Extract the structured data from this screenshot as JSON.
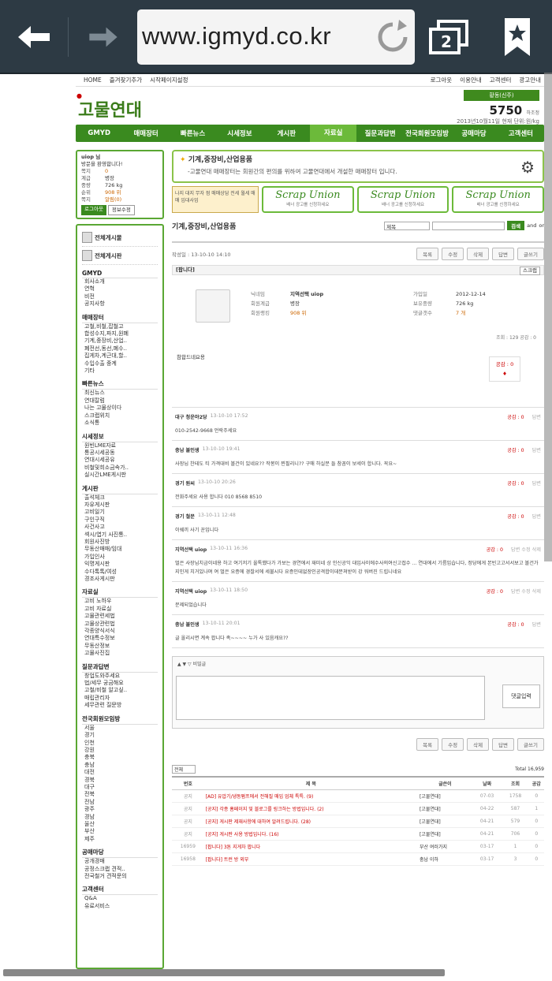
{
  "browser": {
    "url": "www.igmyd.co.kr",
    "tab_count": "2"
  },
  "topbar": {
    "links": [
      "HOME",
      "즐겨찾기추가",
      "시작페이지설정"
    ],
    "right": [
      "로그아웃",
      "이용안내",
      "고객센터",
      "광고안내"
    ]
  },
  "header": {
    "logo": "고물연대",
    "price_label": "황동(신주)",
    "price_value": "5750",
    "price_unit": "하조정",
    "price_date": "2013년10월11일 현재 단위:원/kg"
  },
  "gnav": [
    "GMYD",
    "매매장터",
    "빠른뉴스",
    "시세정보",
    "게시판",
    "자료실",
    "질문과답변",
    "전국회원모임방",
    "공매마당",
    "고객센터"
  ],
  "login": {
    "greet1": "uiop 님",
    "greet2": "방문을 환영합니다!",
    "rows": [
      {
        "k": "쪽지",
        "v": "0"
      },
      {
        "k": "계급",
        "v": "병장"
      },
      {
        "k": "중량",
        "v": "726 kg"
      },
      {
        "k": "순위",
        "v": "908 위"
      },
      {
        "k": "쪽지",
        "v": "알림(0)"
      }
    ],
    "logout": "로그아웃",
    "edit": "정보수정"
  },
  "menu": {
    "all_board": "전체게시물",
    "all_list": "전체게시판",
    "sections": [
      {
        "title": "GMYD",
        "items": [
          "회사소개",
          "연혁",
          "비전",
          "공지사항"
        ]
      },
      {
        "title": "매매장터",
        "items": [
          "고철,비철,잡철고",
          "합성수지,파지,원폐",
          "기계,중장비,산업..",
          "폐전선,동선,폐수..",
          "집게차,계근대,할..",
          "수입수출 중계",
          "기타"
        ]
      },
      {
        "title": "빠른뉴스",
        "items": [
          "최신뉴스",
          "연대칼럼",
          "나는 고물상이다",
          "스크랩위치",
          "소식통"
        ]
      },
      {
        "title": "시세정보",
        "items": [
          "원빈LME자료",
          "통공시세공동",
          "연대시세공유",
          "비철및희소금속가..",
          "실시간LME게시판"
        ]
      },
      {
        "title": "게시판",
        "items": [
          "출석체크",
          "자유게시판",
          "고비일기",
          "구인구직",
          "사건사고",
          "섹시/엽기 사진통..",
          "회원사진방",
          "무동산매매/임대",
          "가입인사",
          "익명게시판",
          "수다톡톡/여성",
          "경조사게시판"
        ]
      },
      {
        "title": "자료실",
        "items": [
          "고비 노하우",
          "고비 자료실",
          "고물관련세법",
          "고물상관련법",
          "각종양식서식",
          "연대특수정보",
          "무동산정보",
          "고물사진집"
        ]
      },
      {
        "title": "질문과답변",
        "items": [
          "창업도와주세요",
          "법/세무 궁금해요",
          "고철/비철 알고싶..",
          "매립관리자",
          "세무관련 질문방"
        ]
      },
      {
        "title": "전국회원모임방",
        "items": [
          "서울",
          "경기",
          "인천",
          "강원",
          "충북",
          "충남",
          "대전",
          "경북",
          "대구",
          "전북",
          "전남",
          "광주",
          "경남",
          "울산",
          "부산",
          "제주"
        ]
      },
      {
        "title": "공매마당",
        "items": [
          "공개경매",
          "공정스크랩 견적..",
          "전국철거 견적문의"
        ]
      },
      {
        "title": "고객센터",
        "items": [
          "Q&A",
          "유료서비스"
        ]
      }
    ]
  },
  "banner": {
    "title": "기계,중장비,산업용품",
    "desc": "-고물연대 매매장터는 회원간의 편의를 위하여 고물연대에서 개설한 매매장터 입니다."
  },
  "ads": {
    "first": "나지 대지 무자 점 매매상담 전세 월세 매매 임대사업",
    "scrap": "Scrap Union",
    "scrap_sub": "배너 광고를 신청하세요"
  },
  "board": {
    "title": "기계,중장비,산업용품",
    "search_sel": "제목",
    "search_go": "검색",
    "and": "and",
    "or": "or"
  },
  "post": {
    "date": "작성일 : 13-10-10 14:10",
    "buttons": [
      "목록",
      "수정",
      "삭제",
      "답변",
      "글쓰기"
    ],
    "category": "[팝니다]",
    "scrap": "스크랩",
    "profile": {
      "k1": "닉네임",
      "v1": "지역선택 uiop",
      "k2": "회원계급",
      "v2": "병장",
      "k3": "회원랭킹",
      "v3": "908 위",
      "k4": "가입일",
      "v4": "2012-12-14",
      "k5": "보유중량",
      "v5": "726 kg",
      "k6": "댓글갯수",
      "v6": "7 개"
    },
    "meta": "조회 : 129  공감 : 0",
    "body": "참합드네요용",
    "like": "공감 : 0"
  },
  "comments": [
    {
      "name": "대구 청운야2당",
      "date": "13-10-10 17:52",
      "like": "공감 : 0",
      "act": "답변",
      "text": "010-2542-9668 언락주세요"
    },
    {
      "name": "충남 불인생",
      "date": "13-10-10 19:41",
      "like": "공감 : 0",
      "act": "답변",
      "text": "사장님 찬테도 티 가격대비 볼건이 있네요?? 작봉이 찐필리니?? 구매 하실분 들 참꼼이 보세이 합니다. 꼭요~"
    },
    {
      "name": "경기 원씨",
      "date": "13-10-10 20:26",
      "like": "공감 : 0",
      "act": "답변",
      "text": "전화주세요 사용 합니다 010 8568 8510"
    },
    {
      "name": "경기 철문",
      "date": "13-10-11 12:48",
      "like": "공감 : 0",
      "act": "답변",
      "text": "이쉐끼 사기 꾼입니다"
    },
    {
      "name": "지역선택 uiop",
      "date": "13-10-11 16:36",
      "like": "공감 : 0",
      "act": "답변 수정 삭제",
      "text": "멀은 사장님치금이네용 하고 여기저기 올톡했다가 가보는 경연에서 재미네 상 인신공익 대입사이에수사의여신고접수 ... 연대에서 기름입습니다, 정당에게 본빈고고서서보고 볼건가지인게 치거있나며 여 멀은 요증에 경찰서에 세불시다 요증인데없장인공격합이데분쳐받이 강 워버진 드립니네요"
    },
    {
      "name": "지역선택 uiop",
      "date": "13-10-11 18:50",
      "like": "공감 : 0",
      "act": "답변 수정 삭제",
      "text": "문제되었습니다"
    },
    {
      "name": "충남 불인생",
      "date": "13-10-11 20:01",
      "like": "공감 : 0",
      "act": "답변",
      "text": "글 올리시면 계속 팝니다 족~~~~ 누가 사 있음캐요??"
    }
  ],
  "comment_box": {
    "secret": "비밀글",
    "submit": "댓글입력"
  },
  "list": {
    "filter": "전체",
    "total": "Total 16,959",
    "headers": [
      "번호",
      "제 목",
      "글쓴이",
      "날짜",
      "조회",
      "공감"
    ],
    "rows": [
      [
        "공지",
        "[AD] 유압기/냉동펌프에서 전해질 매입 업체 특특. (9)",
        "[고물연대]",
        "07-03",
        "1758",
        "0"
      ],
      [
        "공지",
        "[공지] 각종 홈페이지 및 블로그를 링크하는 방법입니다. (2)",
        "[고물연대]",
        "04-22",
        "587",
        "1"
      ],
      [
        "공지",
        "[공지] 게시판 제재사항에 대하여 알려드립니다. (28)",
        "[고물연대]",
        "04-21",
        "579",
        "0"
      ],
      [
        "공지",
        "[공지] 게시판 사용 방법입니다. (16)",
        "[고물연대]",
        "04-21",
        "706",
        "0"
      ],
      [
        "16959",
        "[팝니다] 3톤 지게차 팝니다",
        "부산 여러가지",
        "03-17",
        "1",
        "0"
      ],
      [
        "16958",
        "[팝니다] 트런 방 외부",
        "충남 이하",
        "03-17",
        "3",
        "0"
      ]
    ]
  }
}
